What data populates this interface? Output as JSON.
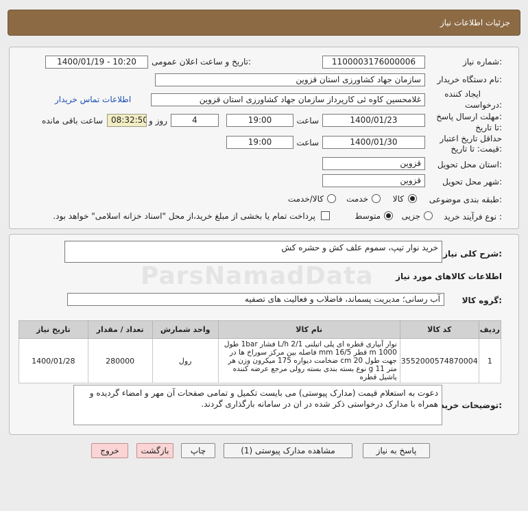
{
  "header": {
    "title": "جزئیات اطلاعات نیاز"
  },
  "form": {
    "need_number_label": "شماره نیاز:",
    "need_number": "1100003176000006",
    "announce_label": "تاریخ و ساعت اعلان عمومی:",
    "announce_value": "1400/01/19 - 10:20",
    "buyer_org_label": "نام دستگاه خریدار:",
    "buyer_org": "سازمان جهاد کشاورزی استان قزوین",
    "creator_label_1": "ایجاد کننده",
    "creator_label_2": "درخواست:",
    "creator": "غلامحسین کاوه ئی کارپرداز سازمان جهاد کشاورزی استان قزوین",
    "contact_link": "اطلاعات تماس خریدار",
    "reply_label_1": "مهلت ارسال پاسخ:",
    "reply_label_2": "تا تاریخ:",
    "reply_date": "1400/01/23",
    "time_label": "ساعت",
    "reply_time": "19:00",
    "days_value": "4",
    "days_label": "روز و",
    "remaining_time": "08:32:50",
    "remaining_label": "ساعت باقی مانده",
    "validity_label_1": "حداقل تاریخ اعتبار",
    "validity_label_2": "قیمت: تا تاریخ:",
    "validity_date": "1400/01/30",
    "validity_time": "19:00",
    "province_label": "استان محل تحویل:",
    "province": "قزوین",
    "city_label": "شهر محل تحویل:",
    "city": "قزوین",
    "category_label": "طبقه بندی موضوعی:",
    "category_options": [
      "کالا",
      "خدمت",
      "کالا/خدمت"
    ],
    "process_label": "نوع فرآیند خرید :",
    "process_options": [
      "جزیی",
      "متوسط"
    ],
    "payment_note": "پرداخت تمام یا بخشی از مبلغ خرید،از محل \"اسناد خزانه اسلامی\" خواهد بود."
  },
  "summary": {
    "label": "شرح کلی نیاز:",
    "text": "خرید نوار تیپ، سموم علف کش و حشره کش"
  },
  "goods": {
    "section_title": "اطلاعات کالاهای مورد نیاز",
    "group_label": "گروه کالا:",
    "group_value": "آب رسانی؛ مدیریت پسماند، فاضلاب و فعالیت های تصفیه",
    "columns": [
      "ردیف",
      "کد کالا",
      "نام کالا",
      "واحد شمارش",
      "تعداد / مقدار",
      "تاریخ نیاز"
    ],
    "rows": [
      {
        "row": "1",
        "code": "3552000574870004",
        "name": "نوار آبیاری قطره ای پلی اتیلنی L/h 2/1 فشار 1bar طول 1000 m قطر 16/5 mm فاصله بین مرکز سوراخ ها در جهت طول 20 cm ضخامت دیواره 175 میکرون وزن هر متر 11 g نوع بسته بندی بسته رولی مرجع عرضه کننده یاشیل قطره",
        "unit": "رول",
        "qty": "280000",
        "date": "1400/01/28"
      }
    ]
  },
  "buyer_notes": {
    "label": "توضیحات خریدار:",
    "text": "دعوت به استعلام قیمت (مدارک پیوستی) می بایست تکمیل و تمامی صفحات آن مهر و امضاء گردیده و همراه با مدارک درخواستی ذکر شده در ان در سامانه بارگذاری گردند."
  },
  "buttons": {
    "reply": "پاسخ به نیاز",
    "view_docs": "مشاهده مدارک پیوستی (1)",
    "print": "چاپ",
    "back": "بازگشت",
    "exit": "خروج"
  },
  "watermark": "ParsNamadData"
}
